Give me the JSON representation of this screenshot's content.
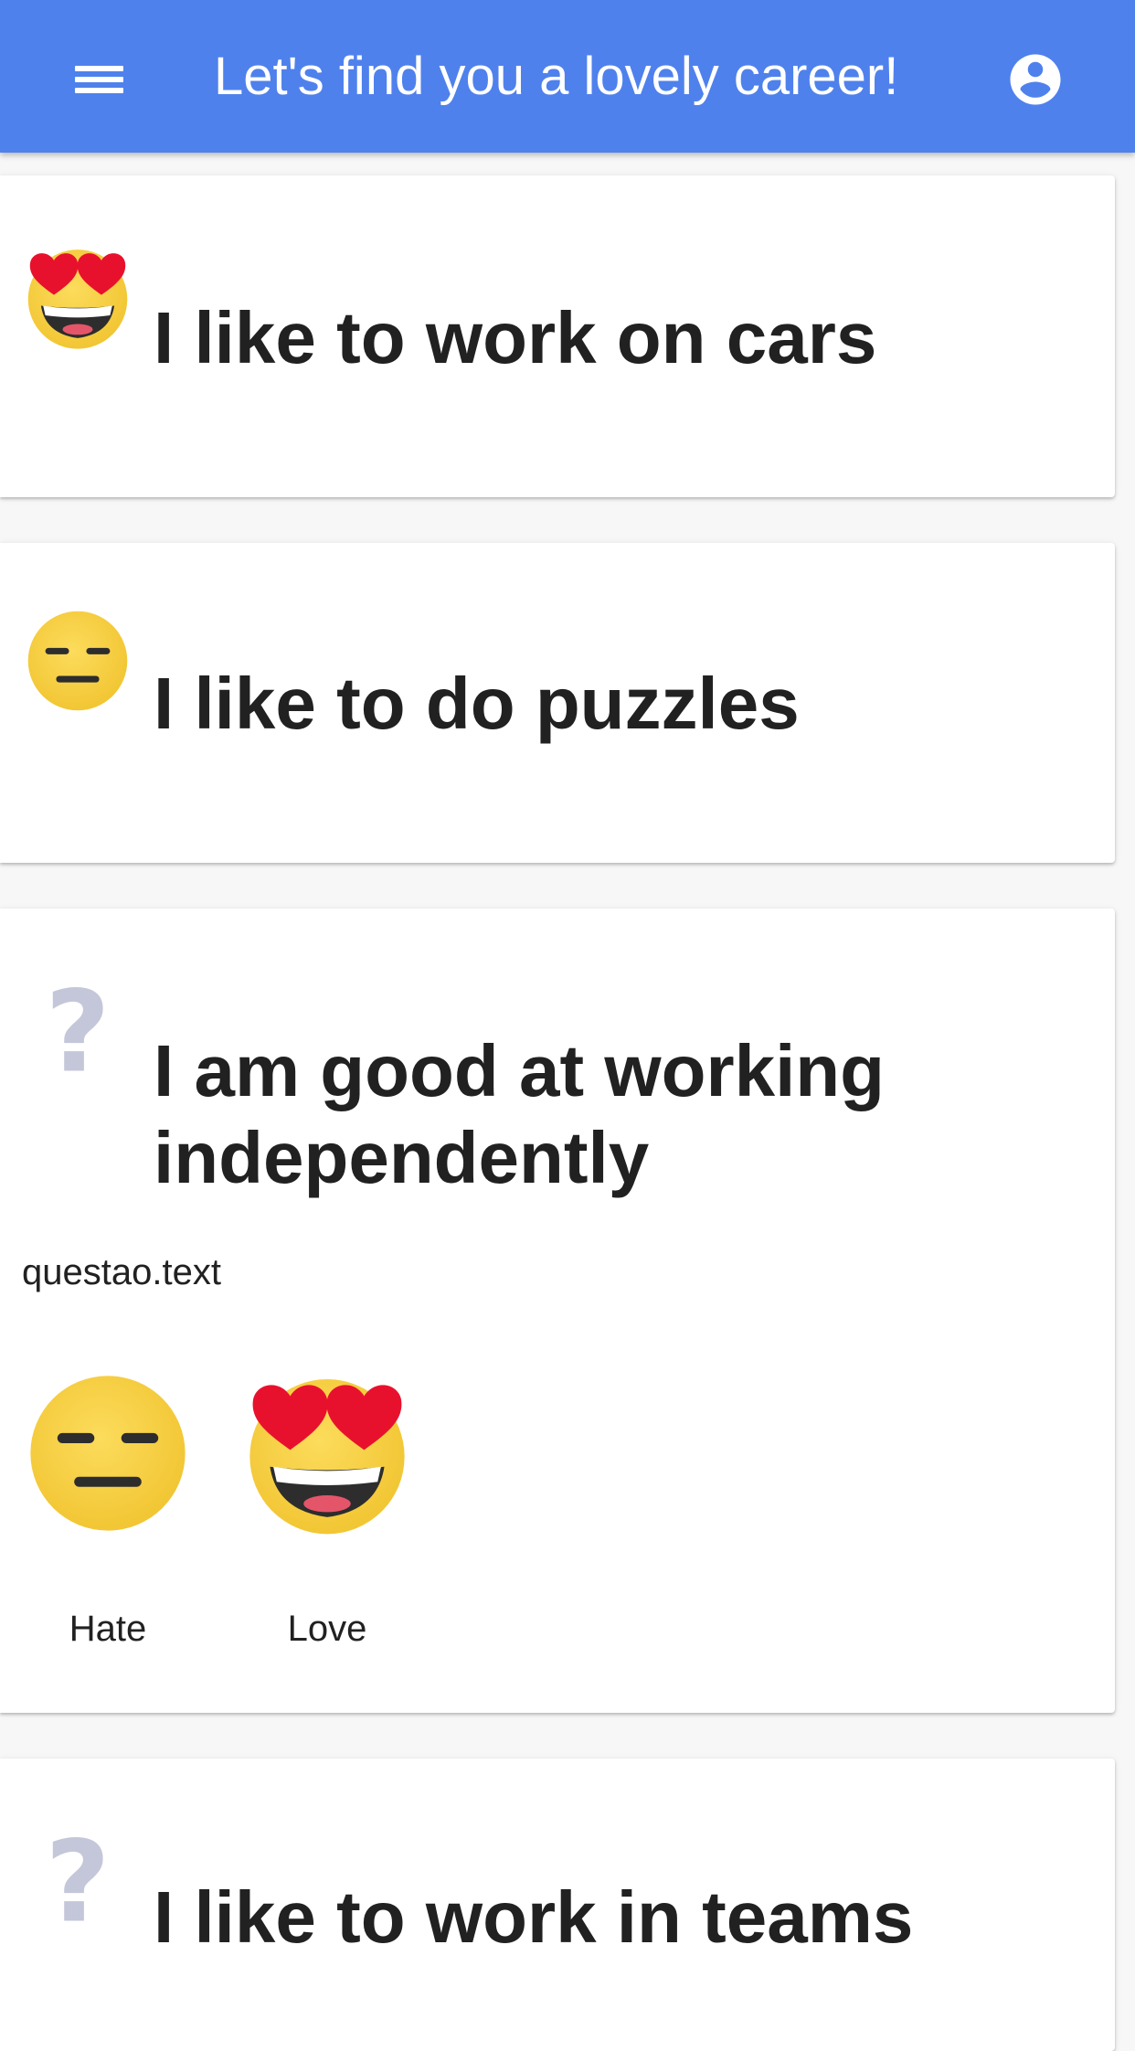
{
  "appbar": {
    "title": "Let's find you a lovely career!",
    "menu_icon": "menu-icon",
    "account_icon": "account-circle-icon",
    "color": "#4f81ed"
  },
  "questions": [
    {
      "title": "I like to work on cars",
      "answer_icon": "heart-eyes-face-icon"
    },
    {
      "title": "I like to do puzzles",
      "answer_icon": "expressionless-face-icon"
    },
    {
      "title": "I am good at working independently",
      "answer_icon": "question-mark-icon",
      "text": "questao.text",
      "choices": [
        {
          "label": "Hate",
          "icon": "expressionless-face-icon"
        },
        {
          "label": "Love",
          "icon": "heart-eyes-face-icon"
        }
      ]
    },
    {
      "title": "I like to work in teams",
      "answer_icon": "question-mark-icon"
    }
  ]
}
